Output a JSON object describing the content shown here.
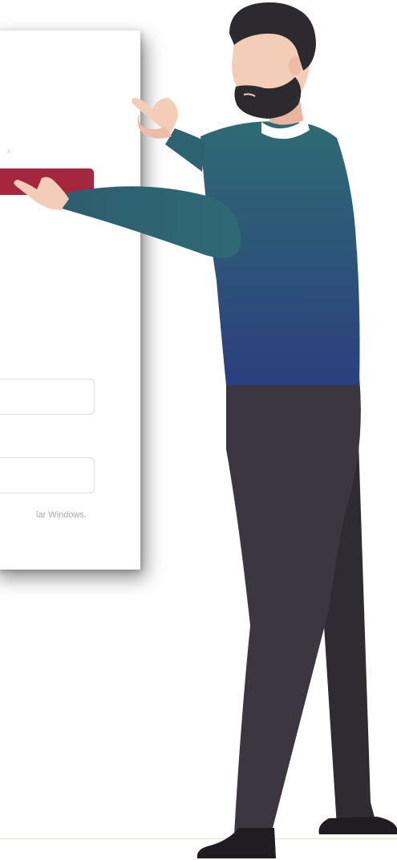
{
  "panel": {
    "hint_text": "iar Windows.",
    "chevron_glyph": "›",
    "primary_color": "#a5273d"
  },
  "illustration": {
    "sweater_top": "#2f6b74",
    "sweater_bottom": "#2b3f7e",
    "pants": "#3b3640",
    "hair": "#2c2a2f",
    "skin": "#f3cdb8"
  }
}
